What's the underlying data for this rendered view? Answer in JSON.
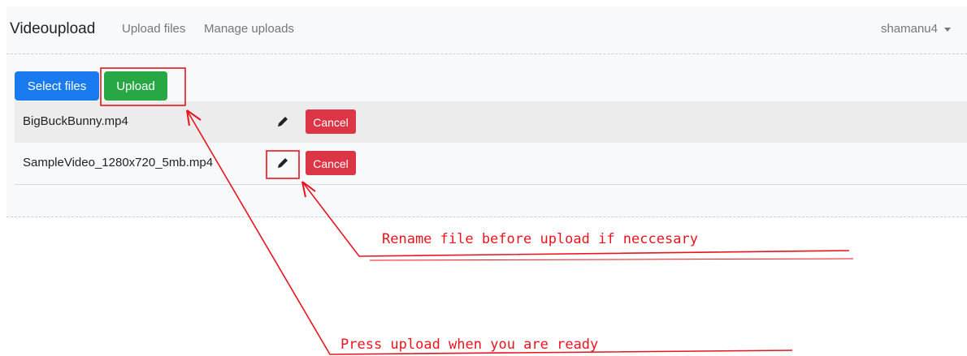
{
  "navbar": {
    "brand": "Videoupload",
    "links": [
      "Upload files",
      "Manage uploads"
    ],
    "user": "shamanu4"
  },
  "uploader": {
    "select_label": "Select files",
    "upload_label": "Upload",
    "files": [
      {
        "name": "BigBuckBunny.mp4",
        "cancel_label": "Cancel",
        "icon": "pencil-icon"
      },
      {
        "name": "SampleVideo_1280x720_5mb.mp4",
        "cancel_label": "Cancel",
        "icon": "pencil-icon"
      }
    ]
  },
  "annotations": {
    "rename_note": "Rename file before upload if neccesary",
    "upload_note": "Press upload when you are ready",
    "color": "#e8141e"
  },
  "colors": {
    "primary": "#1a7bf0",
    "success": "#28a745",
    "danger": "#dc3545"
  }
}
